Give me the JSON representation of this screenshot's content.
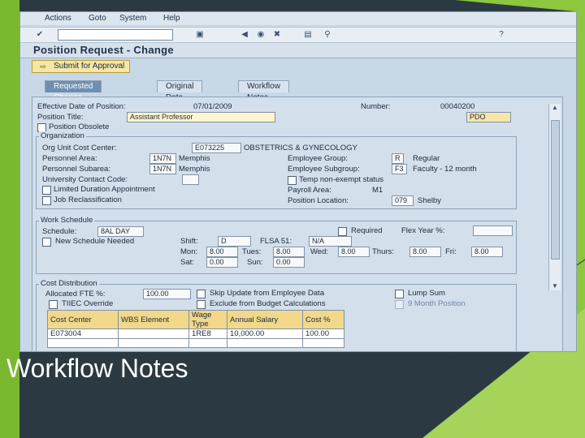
{
  "slide": {
    "caption": "Workflow Notes"
  },
  "menu": {
    "items": [
      "Actions",
      "Goto",
      "System",
      "Help"
    ]
  },
  "title": "Position Request - Change",
  "submit_button": "Submit for Approval",
  "tabs": [
    {
      "label": "Requested Change",
      "active": true
    },
    {
      "label": "Original Data",
      "active": false
    },
    {
      "label": "Workflow Notes",
      "active": false
    }
  ],
  "form": {
    "effective_date_label": "Effective Date of Position:",
    "effective_date_value": "07/01/2009",
    "number_label": "Number:",
    "number_value": "00040200",
    "position_title_label": "Position Title:",
    "position_title_value": "Assistant Professor",
    "pdo_button": "PDO",
    "position_obsolete_label": "Position Obsolete",
    "organization_title": "Organization",
    "org_unit_label": "Org Unit Cost Center:",
    "org_unit_code": "E073225",
    "org_unit_name": "OBSTETRICS & GYNECOLOGY",
    "personnel_area_label": "Personnel Area:",
    "personnel_area_code": "1N7N",
    "personnel_area_name": "Memphis",
    "personnel_subarea_label": "Personnel Subarea:",
    "personnel_subarea_code": "1N7N",
    "personnel_subarea_name": "Memphis",
    "university_contact_label": "University Contact Code:",
    "limited_duration_label": "Limited Duration Appointment",
    "job_reclass_label": "Job Reclassification",
    "employee_group_label": "Employee Group:",
    "employee_group_code": "R",
    "employee_group_name": "Regular",
    "employee_subgroup_label": "Employee Subgroup:",
    "employee_subgroup_code": "F3",
    "employee_subgroup_name": "Faculty - 12 month",
    "temp_exempt_label": "Temp non-exempt status",
    "payroll_area_label": "Payroll Area:",
    "payroll_area_value": "M1",
    "position_location_label": "Position Location:",
    "position_location_code": "079",
    "position_location_name": "Shelby",
    "work_schedule_title": "Work Schedule",
    "schedule_label": "Schedule:",
    "schedule_value": "8AL DAY",
    "required_label": "Required",
    "flex_year_label": "Flex Year %:",
    "new_schedule_label": "New Schedule Needed",
    "shift_label": "Shift:",
    "shift_value": "D",
    "flsa_label": "FLSA 51:",
    "flsa_value": "N/A",
    "mon_label": "Mon:",
    "mon_value": "8.00",
    "tues_label": "Tues:",
    "tues_value": "8.00",
    "wed_label": "Wed:",
    "wed_value": "8.00",
    "thurs_label": "Thurs:",
    "thurs_value": "8.00",
    "fri_label": "Fri:",
    "fri_value": "8.00",
    "sat_label": "Sat:",
    "sat_value": "0.00",
    "sun_label": "Sun:",
    "sun_value": "0.00",
    "cost_distribution_title": "Cost Distribution",
    "allocated_fte_label": "Allocated FTE %:",
    "allocated_fte_value": "100.00",
    "skip_update_label": "Skip Update from Employee Data",
    "lump_sum_label": "Lump Sum",
    "tiiec_override_label": "TIIEC Override",
    "exclude_budget_label": "Exclude from Budget Calculations",
    "nine_month_label": "9 Month Position"
  },
  "cost_table": {
    "headers": [
      "Cost Center",
      "WBS Element",
      "Wage Type",
      "Annual Salary",
      "Cost %"
    ],
    "rows": [
      [
        "E073004",
        "",
        "1RE8",
        "10,000.00",
        "100.00"
      ]
    ]
  },
  "colors": {
    "accent": "#8dc63f",
    "panel": "#d3dfeb"
  },
  "icons": [
    "check-icon",
    "save-icon",
    "back-icon",
    "exit-icon",
    "cancel-icon",
    "print-icon",
    "find-icon",
    "help-icon"
  ]
}
